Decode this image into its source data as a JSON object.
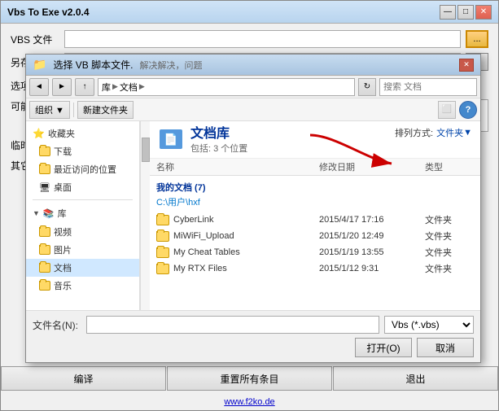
{
  "window": {
    "title": "Vbs To Exe v2.0.4",
    "min_btn": "—",
    "max_btn": "□",
    "close_btn": "✕"
  },
  "main": {
    "vbs_label": "VBS 文件",
    "saveas_label": "另存为",
    "options_label": "选项",
    "possible_label": "可能",
    "temp_label": "临时",
    "other_label": "其它"
  },
  "bottom_buttons": {
    "compile": "编译",
    "reset": "重置所有条目",
    "exit": "退出"
  },
  "footer": {
    "link": "www.f2ko.de"
  },
  "dialog": {
    "title": "选择 VB 脚本文件.",
    "title_suffix": "解决解决，问题",
    "close_btn": "✕",
    "nav": {
      "back": "◄",
      "forward": "►",
      "up": "▲",
      "breadcrumb": [
        "库",
        "文档"
      ],
      "refresh": "↻",
      "search_placeholder": "搜索 文档"
    },
    "toolbar": {
      "organize": "组织 ▼",
      "new_folder": "新建文件夹"
    },
    "sidebar": {
      "favorites_label": "收藏夹",
      "download": "下载",
      "recent": "最近访问的位置",
      "desktop": "桌面",
      "library_label": "库",
      "video": "视频",
      "picture": "图片",
      "document": "文档",
      "music": "音乐"
    },
    "main_area": {
      "library_title": "文档库",
      "includes": "包括: 3 个位置",
      "sort_label": "排列方式:",
      "sort_value": "文件夹",
      "sort_arrow": "▼",
      "columns": {
        "name": "名称",
        "modified": "修改日期",
        "type": "类型"
      },
      "my_docs": {
        "header": "我的文档 (7)",
        "path": "C:\\用户\\hxf"
      },
      "files": [
        {
          "name": "CyberLink",
          "modified": "2015/4/17 17:16",
          "type": "文件夹"
        },
        {
          "name": "MiWiFi_Upload",
          "modified": "2015/1/20 12:49",
          "type": "文件夹"
        },
        {
          "name": "My Cheat Tables",
          "modified": "2015/1/19 13:55",
          "type": "文件夹"
        },
        {
          "name": "My RTX Files",
          "modified": "2015/1/12 9:31",
          "type": "文件夹"
        }
      ]
    },
    "bottom": {
      "filename_label": "文件名(N):",
      "filename_value": "",
      "filetype_value": "Vbs (*.vbs)",
      "open_btn": "打开(O)",
      "cancel_btn": "取消"
    }
  }
}
